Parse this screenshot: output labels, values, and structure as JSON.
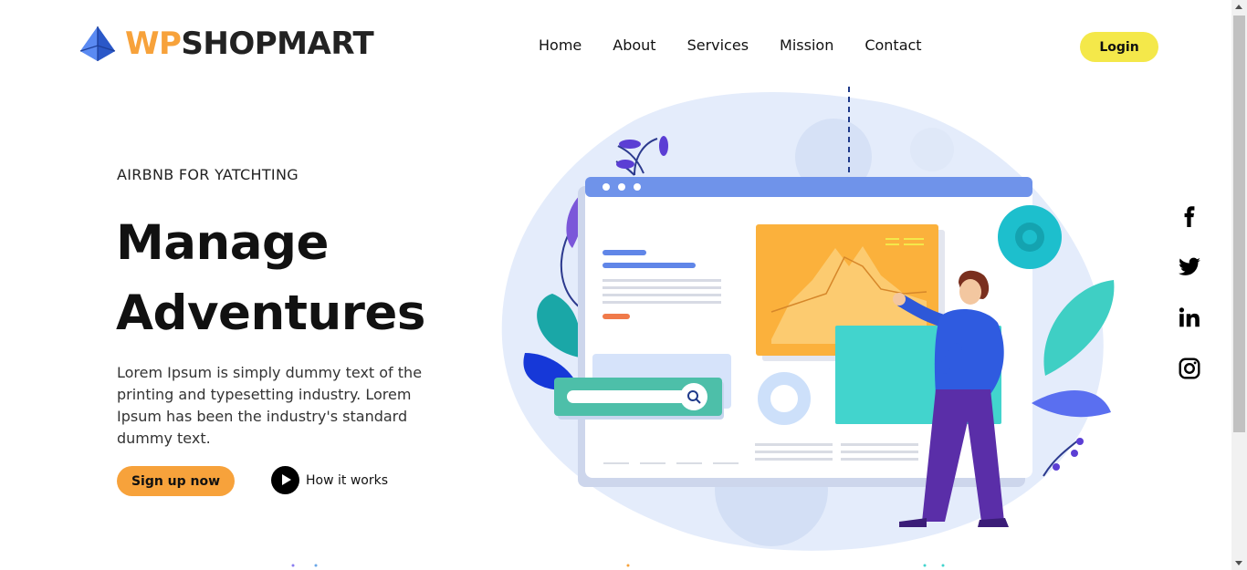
{
  "brand": {
    "name_part1": "WP",
    "name_part2": "SHOPMART",
    "logo_icon": "pyramid-icon",
    "colors": {
      "accent_orange": "#f7a23b",
      "accent_yellow": "#f4e84a",
      "logo_blue": "#3b6fe0"
    }
  },
  "nav": {
    "items": [
      {
        "label": "Home"
      },
      {
        "label": "About"
      },
      {
        "label": "Services"
      },
      {
        "label": "Mission"
      },
      {
        "label": "Contact"
      }
    ],
    "login_label": "Login"
  },
  "hero": {
    "eyebrow": "AIRBNB FOR YATCHTING",
    "headline_line1": "Manage",
    "headline_line2": "Adventures",
    "description": "Lorem Ipsum is simply dummy text of the printing and typesetting industry. Lorem Ipsum has been the industry's standard dummy text.",
    "signup_label": "Sign up now",
    "how_it_works_label": "How it works"
  },
  "social": {
    "icons": [
      "facebook-icon",
      "twitter-icon",
      "linkedin-icon",
      "instagram-icon"
    ]
  }
}
